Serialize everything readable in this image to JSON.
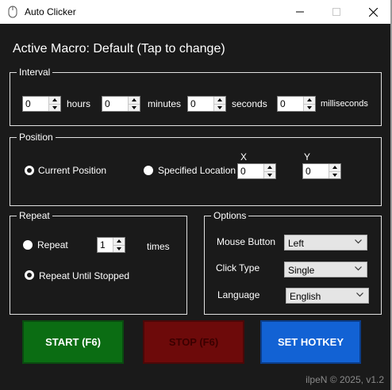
{
  "window": {
    "title": "Auto Clicker"
  },
  "macro": {
    "label": "Active Macro: Default (Tap to change)"
  },
  "interval": {
    "title": "Interval",
    "hours": {
      "value": "0",
      "label": "hours"
    },
    "minutes": {
      "value": "0",
      "label": "minutes"
    },
    "seconds": {
      "value": "0",
      "label": "seconds"
    },
    "milliseconds": {
      "value": "0",
      "label": "milliseconds"
    }
  },
  "position": {
    "title": "Position",
    "current_label": "Current Position",
    "specified_label": "Specified Location",
    "selected": "current",
    "x_label": "X",
    "y_label": "Y",
    "x_value": "0",
    "y_value": "0"
  },
  "repeat": {
    "title": "Repeat",
    "repeat_label": "Repeat",
    "times_value": "1",
    "times_label": "times",
    "until_stopped_label": "Repeat Until Stopped",
    "selected": "until_stopped"
  },
  "options": {
    "title": "Options",
    "mouse_button": {
      "label": "Mouse Button",
      "value": "Left"
    },
    "click_type": {
      "label": "Click Type",
      "value": "Single"
    },
    "language": {
      "label": "Language",
      "value": "English"
    }
  },
  "buttons": {
    "start": "START (F6)",
    "stop": "STOP (F6)",
    "hotkey": "SET HOTKEY"
  },
  "footer": "ilpeN © 2025, v1.2",
  "colors": {
    "background": "#1a1a1a",
    "start": "#0b6d13",
    "stop": "#6d0a0a",
    "hotkey": "#1262d4"
  }
}
